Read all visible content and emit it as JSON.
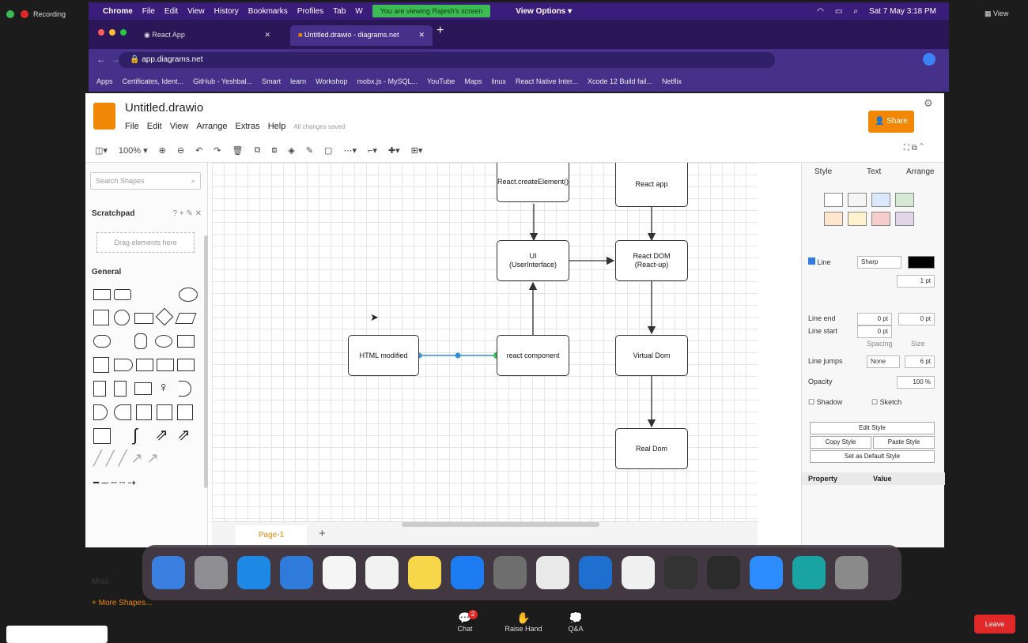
{
  "zoom": {
    "recording_label": "Recording",
    "view_label": "View",
    "leave_label": "Leave",
    "chat_label": "Chat",
    "raise_hand_label": "Raise Hand",
    "qa_label": "Q&A",
    "chat_badge": "2"
  },
  "menubar": {
    "items": [
      "Chrome",
      "File",
      "Edit",
      "View",
      "History",
      "Bookmarks",
      "Profiles",
      "Tab",
      "W"
    ],
    "share_banner": "You are viewing Rajesh's screen",
    "view_options": "View Options ▾",
    "datetime": "Sat 7 May 3:18 PM"
  },
  "browser": {
    "tab1_title": "React App",
    "tab2_title": "Untitled.drawio - diagrams.net",
    "url": "app.diagrams.net",
    "bookmarks": [
      "Apps",
      "Certificates, Ident...",
      "GitHub - Yeshbal...",
      "Smart",
      "learn",
      "Workshop",
      "mobx.js - MySQL...",
      "YouTube",
      "Maps",
      "linux",
      "React Native Inter...",
      "Xcode 12 Build fail...",
      "Netflix"
    ]
  },
  "drawio": {
    "title": "Untitled.drawio",
    "menu": [
      "File",
      "Edit",
      "View",
      "Arrange",
      "Extras",
      "Help"
    ],
    "unsaved": "All changes saved",
    "share": "Share",
    "zoom": "100% ▾",
    "search_placeholder": "Search Shapes",
    "scratchpad": "Scratchpad",
    "drag_hint": "Drag elements here",
    "general": "General",
    "misc": "Misc",
    "more_shapes": "+ More Shapes...",
    "page_tab": "Page-1"
  },
  "diagram": {
    "n_create": "React.createElement()",
    "n_reactapp": "React app",
    "n_ui": "UI\n(UserInterface)",
    "n_reactdom": "React DOM\n(React-up)",
    "n_html": "HTML modified",
    "n_component": "react component",
    "n_vdom": "Virtual Dom",
    "n_realdom": "Real Dom"
  },
  "format": {
    "tabs": [
      "Style",
      "Text",
      "Arrange"
    ],
    "line_label": "Line",
    "line_color": "Sharp",
    "width": "1 pt",
    "line_end": "Line end",
    "line_start": "Line start",
    "end_val": "0 pt",
    "start_val": "0 pt",
    "size_val": "0 pt",
    "spacing": "Spacing",
    "size": "Size",
    "line_jumps": "Line jumps",
    "jump_val": "None",
    "jump_size": "6 pt",
    "opacity": "Opacity",
    "opacity_val": "100 %",
    "shadow": "Shadow",
    "sketch": "Sketch",
    "edit_style": "Edit Style",
    "copy_style": "Copy Style",
    "paste_style": "Paste Style",
    "set_default": "Set as Default Style",
    "property": "Property",
    "value": "Value",
    "swatches": [
      "#ffffff",
      "#f5f5f5",
      "#dae8fc",
      "#d5e8d4",
      "#ffe6cc",
      "#fff2cc",
      "#f8cecc",
      "#e1d5e7"
    ]
  },
  "dock_colors": [
    "#3b7fe0",
    "#8e8e93",
    "#1e88e5",
    "#2e7bdb",
    "#f5f5f5",
    "#f2f2f2",
    "#f7d64a",
    "#1e7cf2",
    "#6e6e6e",
    "#e9e9e9",
    "#1f6fd0",
    "#f0f0f0",
    "#333333",
    "#2b2b2b",
    "#2d8cff",
    "#1aa3a3",
    "#8a8a8a"
  ]
}
